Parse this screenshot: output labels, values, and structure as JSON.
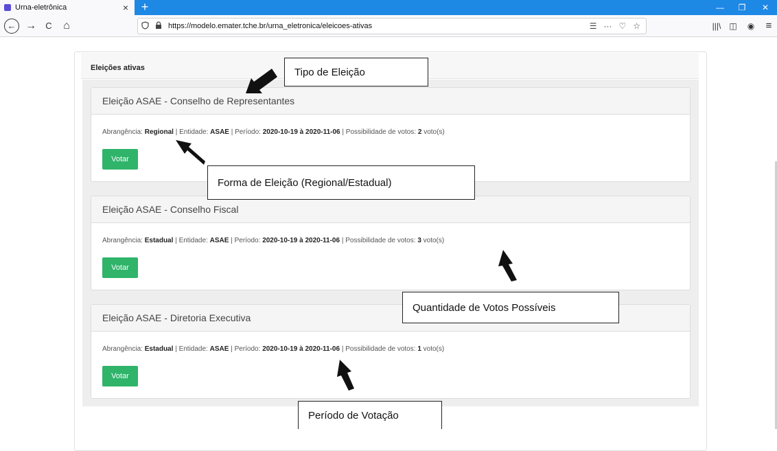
{
  "browser": {
    "tab_title": "Urna-eletrônica",
    "tab_close": "×",
    "new_tab": "+",
    "url": "https://modelo.emater.tche.br/urna_eletronica/eleicoes-ativas",
    "window_controls": {
      "minimize": "—",
      "restore": "❐",
      "close": "✕"
    },
    "nav": {
      "back": "←",
      "forward": "→",
      "reload": "C",
      "home": "⌂"
    },
    "url_actions": {
      "reader": "☰",
      "more": "···",
      "pocket": "♡",
      "bookmark": "☆"
    },
    "toolbar": {
      "library": "|||\\",
      "sidebar": "◫",
      "account": "◉",
      "menu": "≡"
    }
  },
  "page": {
    "section_title": "Eleições ativas",
    "vote_label": "Votar",
    "labels": {
      "scope": "Abrangência:",
      "entity": "Entidade:",
      "period": "Período:",
      "votes": "Possibilidade de votos:",
      "votes_unit": "voto(s)",
      "sep": "|"
    },
    "elections": [
      {
        "title": "Eleição ASAE - Conselho de Representantes",
        "scope": "Regional",
        "entity": "ASAE",
        "period": "2020-10-19 à 2020-11-06",
        "votes": "2"
      },
      {
        "title": "Eleição ASAE - Conselho Fiscal",
        "scope": "Estadual",
        "entity": "ASAE",
        "period": "2020-10-19 à 2020-11-06",
        "votes": "3"
      },
      {
        "title": "Eleição ASAE - Diretoria Executiva",
        "scope": "Estadual",
        "entity": "ASAE",
        "period": "2020-10-19 à 2020-11-06",
        "votes": "1"
      }
    ]
  },
  "annotations": {
    "tipo": "Tipo de Eleição",
    "forma": "Forma de Eleição (Regional/Estadual)",
    "quantidade": "Quantidade de Votos Possíveis",
    "periodo": "Período de Votação"
  },
  "colors": {
    "chrome_blue": "#1e88e5",
    "vote_button": "#2fb46a"
  }
}
